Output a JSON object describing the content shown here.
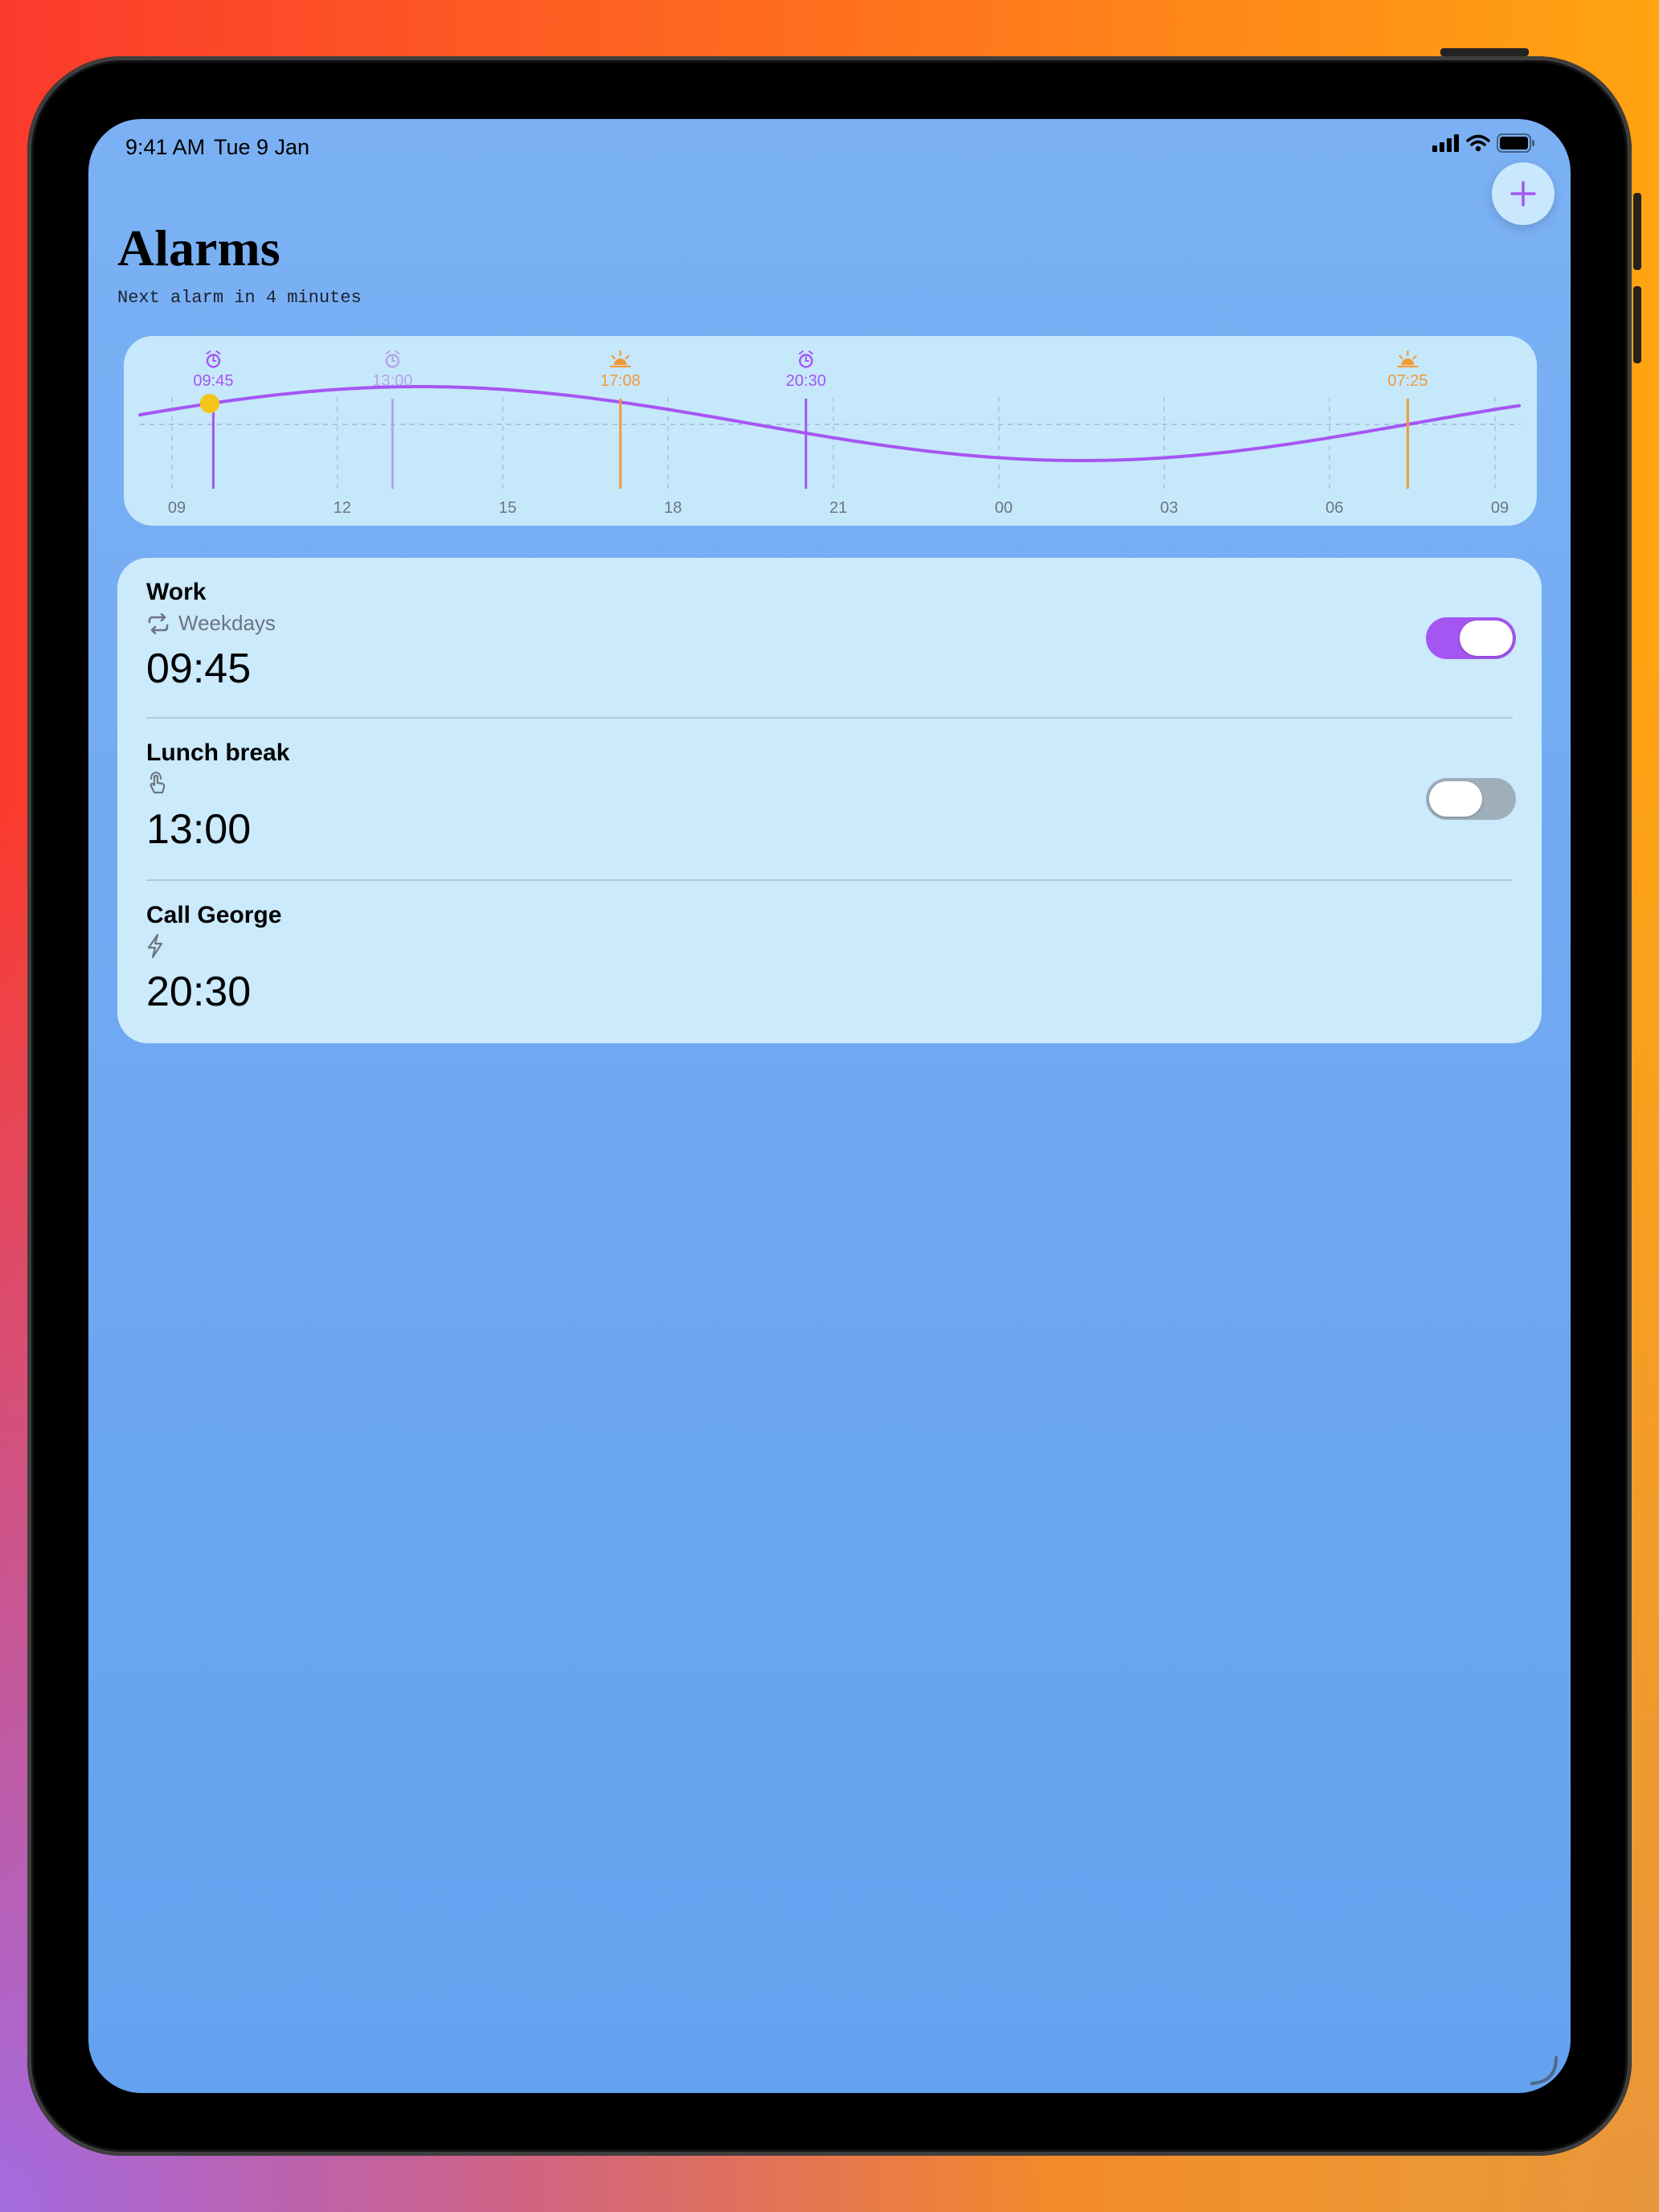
{
  "status_bar": {
    "time": "9:41 AM",
    "date": "Tue 9 Jan"
  },
  "header": {
    "title": "Alarms",
    "subtitle": "Next alarm in 4 minutes"
  },
  "colors": {
    "accent": "#a556f2",
    "sun": "#f29a3a",
    "now_marker": "#f5c518",
    "disabled_marker": "#b4a3ea"
  },
  "timeline": {
    "hour_labels": [
      "09",
      "12",
      "15",
      "18",
      "21",
      "00",
      "03",
      "06",
      "09"
    ],
    "markers": [
      {
        "time": "09:45",
        "icon": "alarm-clock-icon",
        "kind": "alarm-enabled"
      },
      {
        "time": "13:00",
        "icon": "alarm-clock-icon",
        "kind": "alarm-disabled"
      },
      {
        "time": "17:08",
        "icon": "sunset-icon",
        "kind": "sun"
      },
      {
        "time": "20:30",
        "icon": "alarm-clock-icon",
        "kind": "alarm-enabled"
      },
      {
        "time": "07:25",
        "icon": "sunrise-icon",
        "kind": "sun"
      }
    ]
  },
  "alarms": [
    {
      "name": "Work",
      "repeat_icon": "repeat-icon",
      "repeat_label": "Weekdays",
      "time": "09:45",
      "enabled": true
    },
    {
      "name": "Lunch break",
      "repeat_icon": "tap-icon",
      "repeat_label": "",
      "time": "13:00",
      "enabled": false
    },
    {
      "name": "Call George",
      "repeat_icon": "lightning-icon",
      "repeat_label": "",
      "time": "20:30"
    }
  ]
}
